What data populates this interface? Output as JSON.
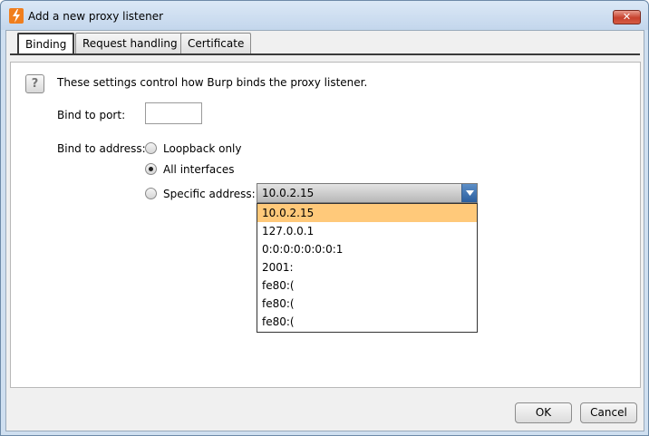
{
  "window": {
    "title": "Add a new proxy listener",
    "app_icon": "burp-lightning-icon",
    "close_label": "✕"
  },
  "tabs": [
    {
      "label": "Binding",
      "active": true
    },
    {
      "label": "Request handling",
      "active": false
    },
    {
      "label": "Certificate",
      "active": false
    }
  ],
  "binding": {
    "help_icon_label": "?",
    "intro": "These settings control how Burp binds the proxy listener.",
    "port_label": "Bind to port:",
    "port_value": "",
    "address_label": "Bind to address:",
    "options": [
      {
        "label": "Loopback only",
        "checked": false
      },
      {
        "label": "All interfaces",
        "checked": true
      },
      {
        "label": "Specific address:",
        "checked": false
      }
    ],
    "specific_address": {
      "selected": "10.0.2.15",
      "list": [
        "10.0.2.15",
        "127.0.0.1",
        "0:0:0:0:0:0:0:1",
        "2001:",
        "fe80:(",
        "fe80:(",
        "fe80:("
      ]
    }
  },
  "footer": {
    "ok_label": "OK",
    "cancel_label": "Cancel"
  },
  "colors": {
    "dropdown_highlight": "#ffc97a",
    "close_button": "#c7412d",
    "combo_arrow": "#2b5e9e"
  }
}
